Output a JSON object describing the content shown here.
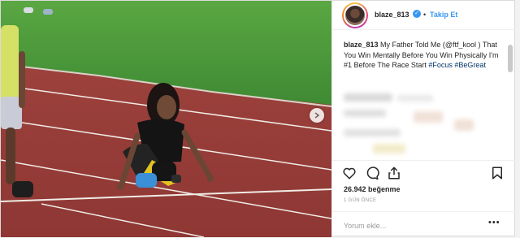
{
  "post": {
    "username": "blaze_813",
    "verified_mark": "✓",
    "separator": "•",
    "follow_label": "Takip Et",
    "caption": {
      "username": "blaze_813",
      "text": " My Father Told Me (@ftf_kool ) That You Win Mentally Before You Win Physically I'm #1 Before The Race Start ",
      "hashtags": "#Focus #BeGreat"
    },
    "likes": "26.942 beğenme",
    "time_ago": "1 GÜN ÖNCE",
    "comment_placeholder": "Yorum ekle...",
    "more_label": "•••"
  },
  "icons": {
    "like": "heart-icon",
    "comment": "comment-bubble-icon",
    "share": "share-icon",
    "save": "bookmark-icon",
    "next": "chevron-right-icon"
  },
  "colors": {
    "accent": "#3897f0",
    "track": "#9a3f3a",
    "grass": "#4f9a3c",
    "hashtag": "#003569"
  }
}
